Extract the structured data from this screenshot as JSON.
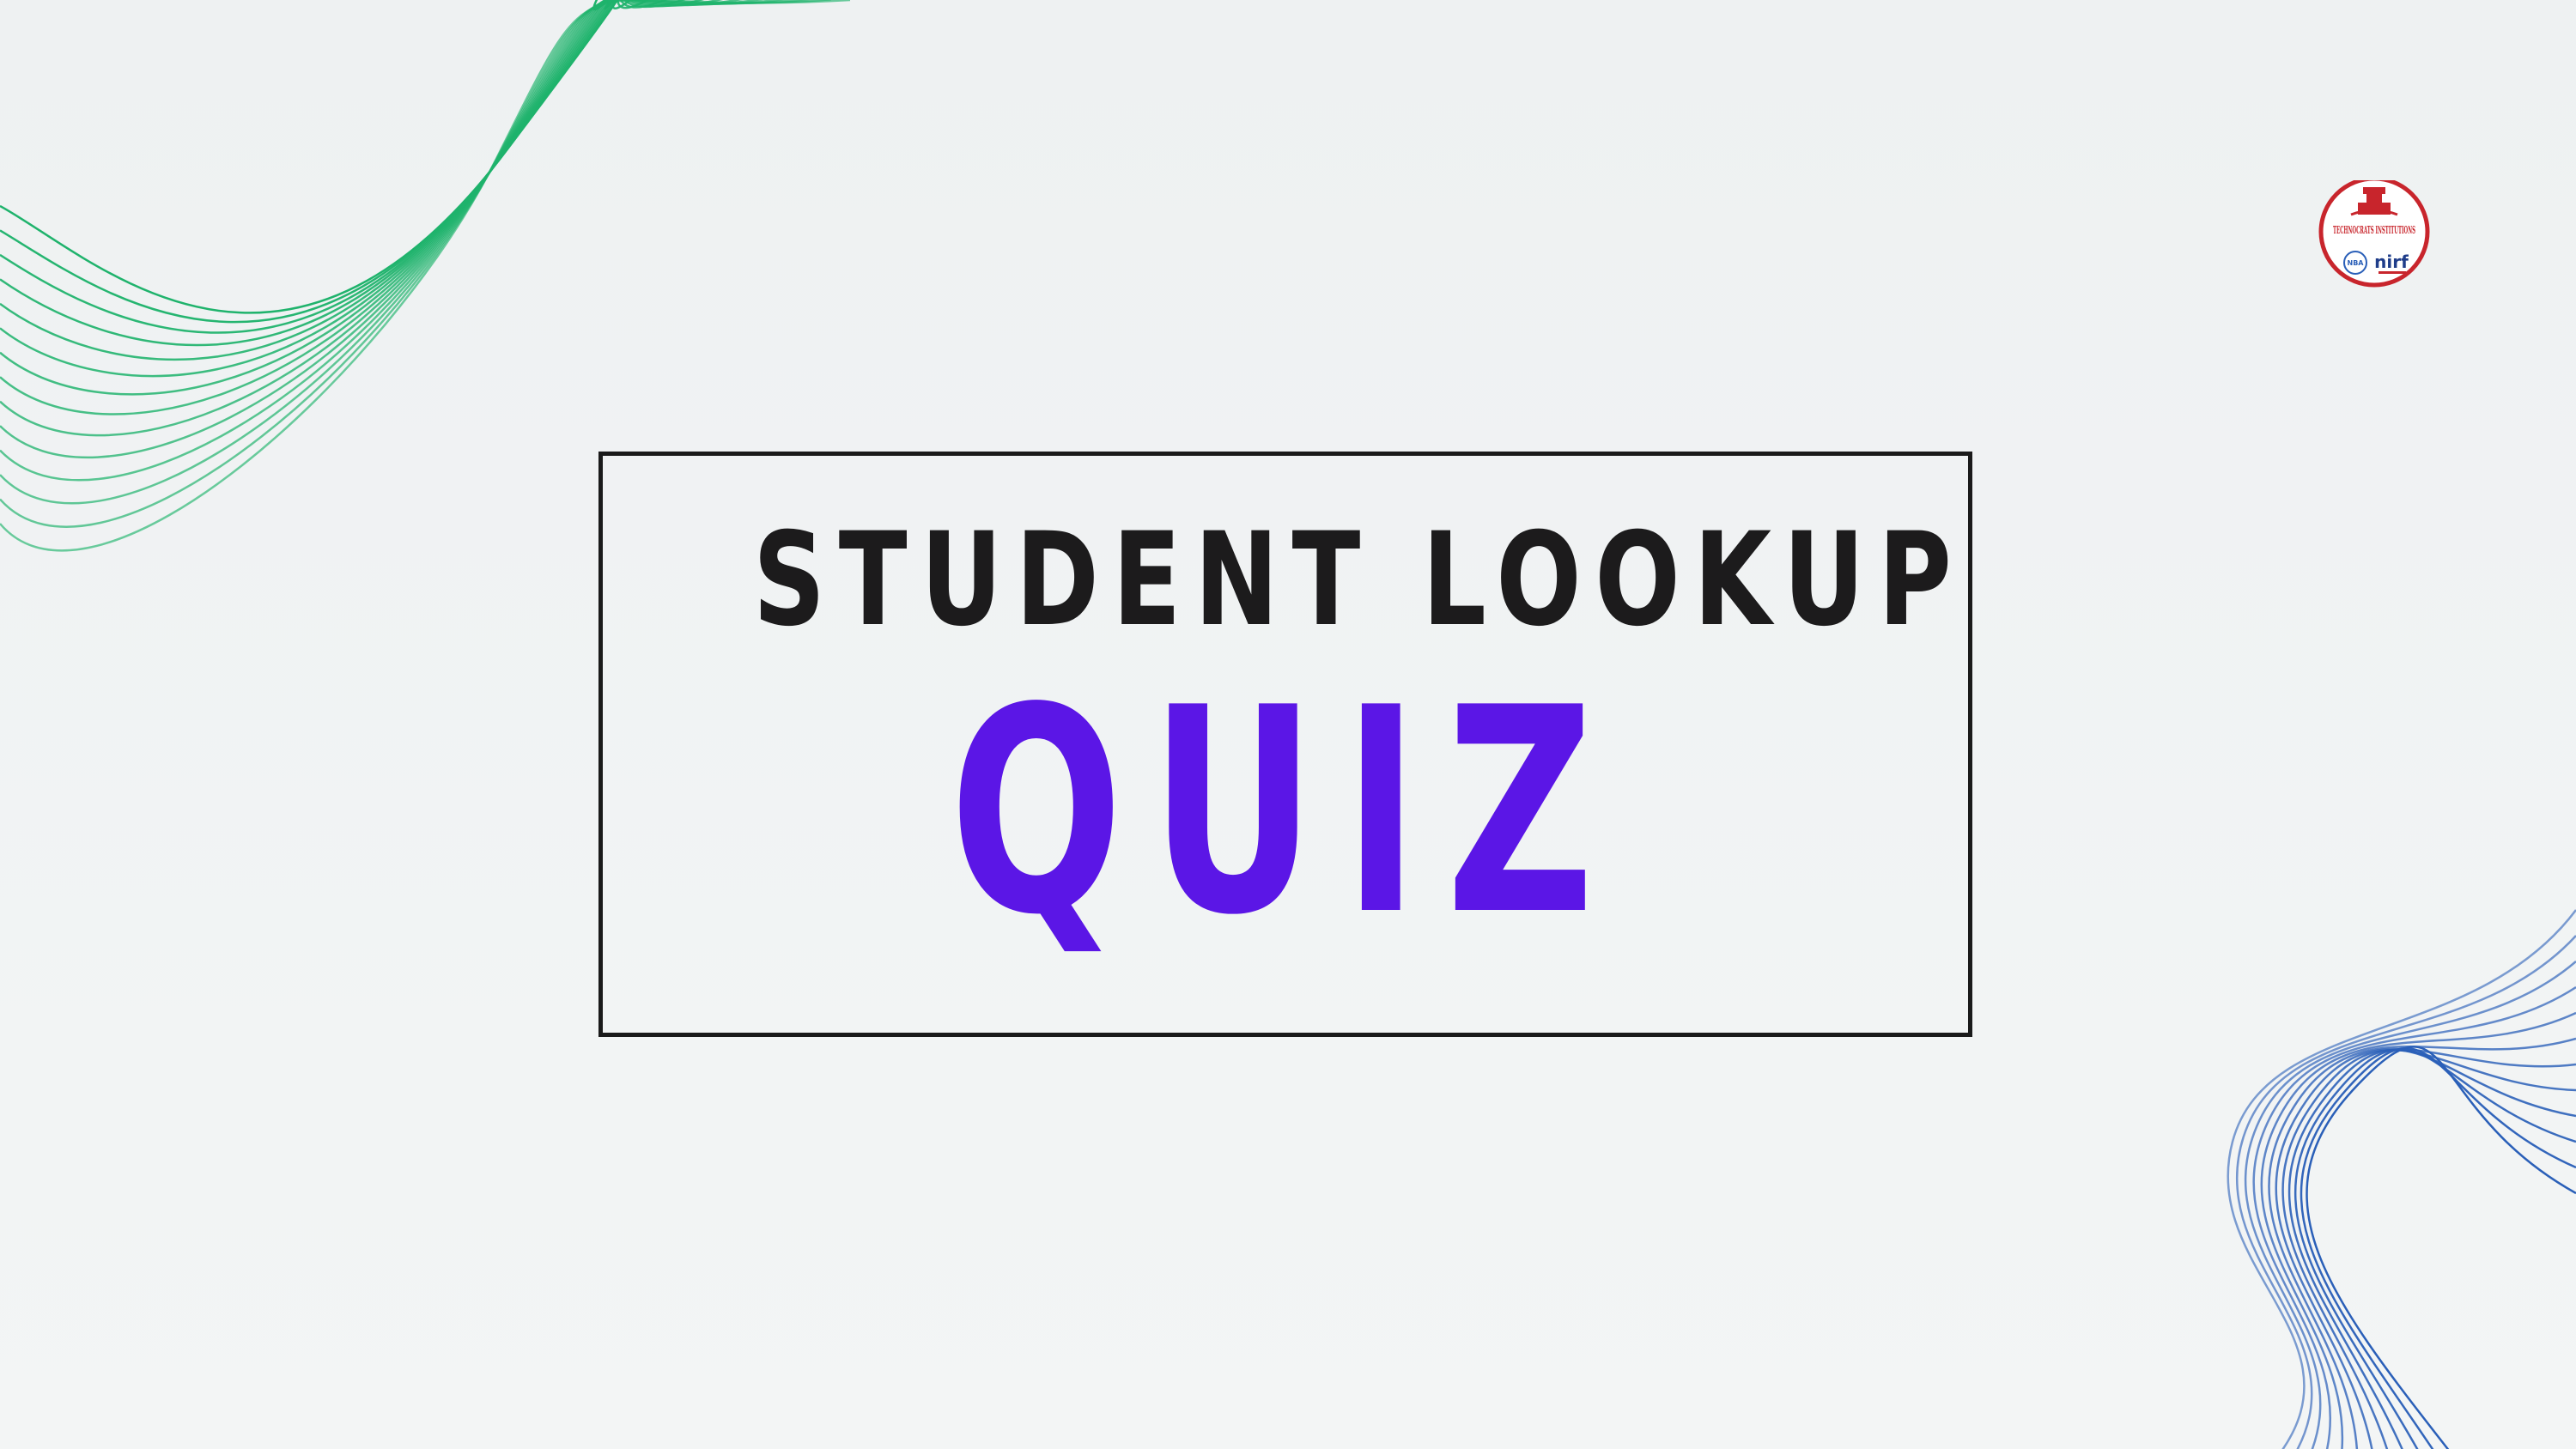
{
  "slide": {
    "heading": "STUDENT LOOKUP",
    "subheading": "QUIZ"
  },
  "logo": {
    "name": "TECHNOCRATS INSTITUTIONS",
    "badge_left": "NBA",
    "badge_right": "nirf"
  },
  "colors": {
    "background": "#f0f3f3",
    "heading": "#1c1b1c",
    "accent": "#5b16e6",
    "box_border": "#1a1a1a",
    "wave_green": "#1fb36c",
    "wave_blue": "#2a5fb8",
    "logo_red": "#c8252c"
  }
}
